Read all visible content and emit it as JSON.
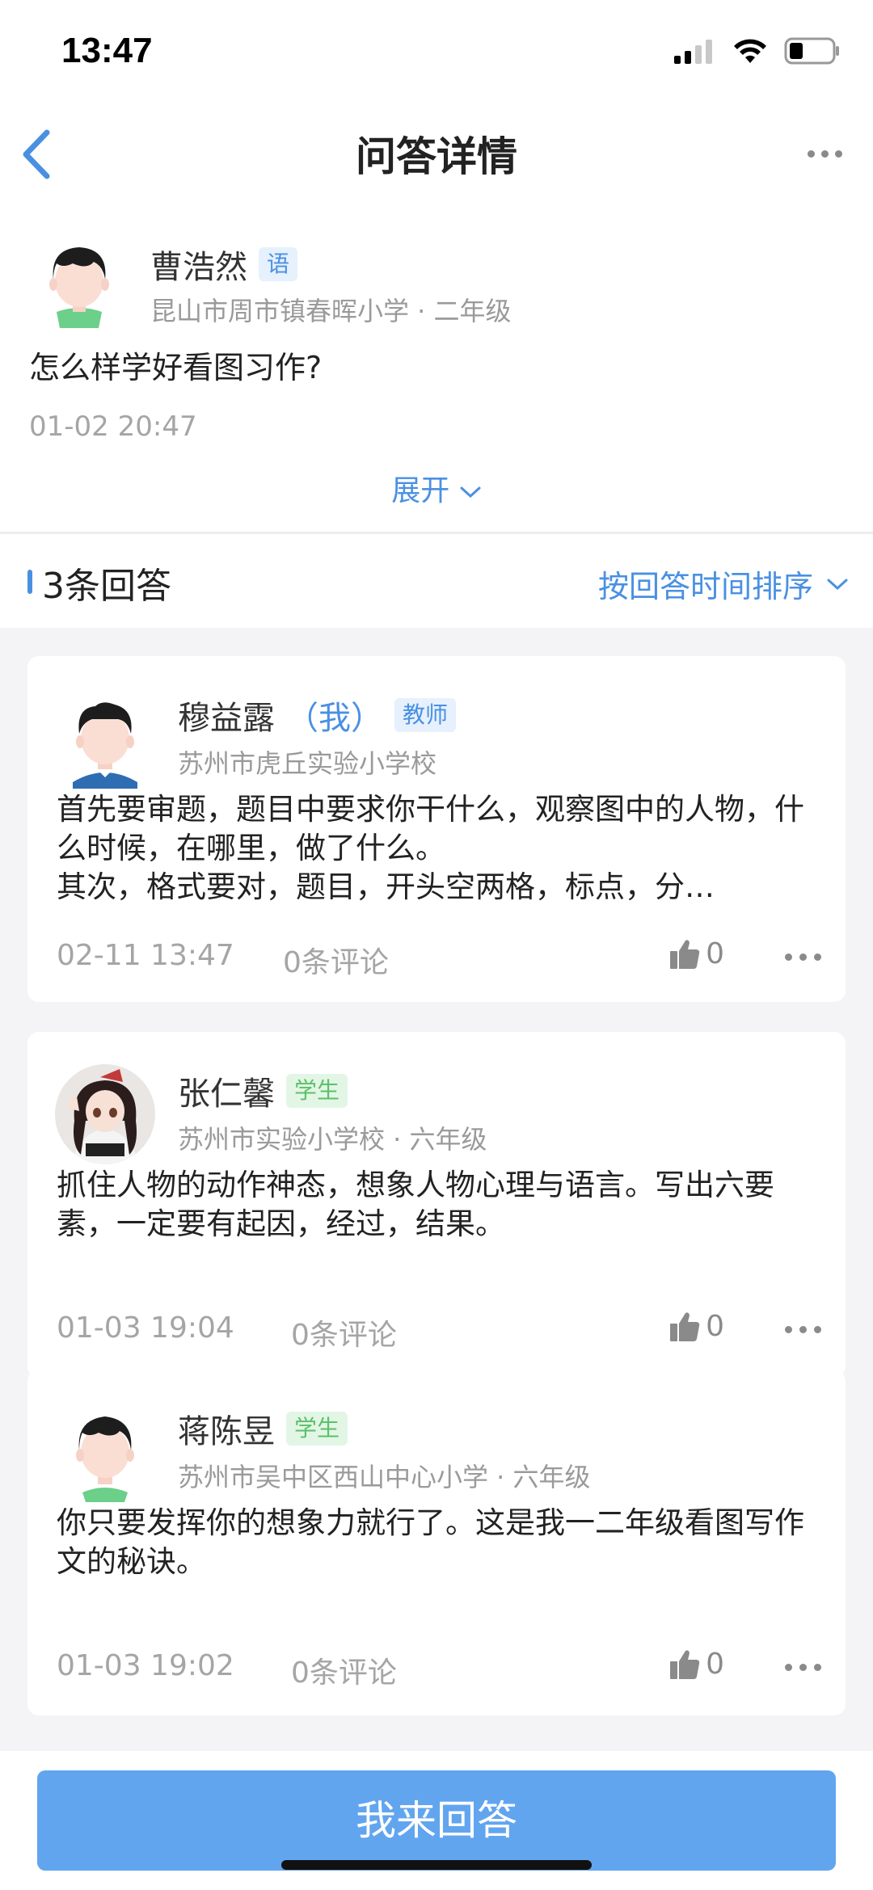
{
  "status_bar": {
    "time": "13:47"
  },
  "nav": {
    "title": "问答详情"
  },
  "question": {
    "author": "曹浩然",
    "subject_tag": "语",
    "school": "昆山市周市镇春晖小学 · 二年级",
    "text": "怎么样学好看图习作?",
    "time": "01-02 20:47",
    "expand_label": "展开"
  },
  "answers_header": {
    "count_label": "3条回答",
    "sort_label": "按回答时间排序"
  },
  "answers": [
    {
      "name": "穆益露",
      "me_label": "（我）",
      "role_tag": "教师",
      "school": "苏州市虎丘实验小学校",
      "text": "首先要审题，题目中要求你干什么，观察图中的人物，什么时候，在哪里，做了什么。\n其次，格式要对，题目，开头空两格，标点，分…",
      "time": "02-11 13:47",
      "comments": "0条评论",
      "likes": "0"
    },
    {
      "name": "张仁馨",
      "role_tag": "学生",
      "school": "苏州市实验小学校 · 六年级",
      "text": "抓住人物的动作神态，想象人物心理与语言。写出六要素，一定要有起因，经过，结果。",
      "time": "01-03 19:04",
      "comments": "0条评论",
      "likes": "0"
    },
    {
      "name": "蒋陈昱",
      "role_tag": "学生",
      "school": "苏州市吴中区西山中心小学 · 六年级",
      "text": "你只要发挥你的想象力就行了。这是我一二年级看图写作文的秘诀。",
      "time": "01-03 19:02",
      "comments": "0条评论",
      "likes": "0"
    }
  ],
  "bottom": {
    "answer_button": "我来回答"
  },
  "colors": {
    "accent": "#4a90e2",
    "button": "#62a5ef",
    "teacher_tag_bg": "#e6f1fd",
    "student_tag_bg": "#e3f6e5",
    "student_tag_text": "#5bc06a",
    "list_bg": "#f4f4f6"
  }
}
